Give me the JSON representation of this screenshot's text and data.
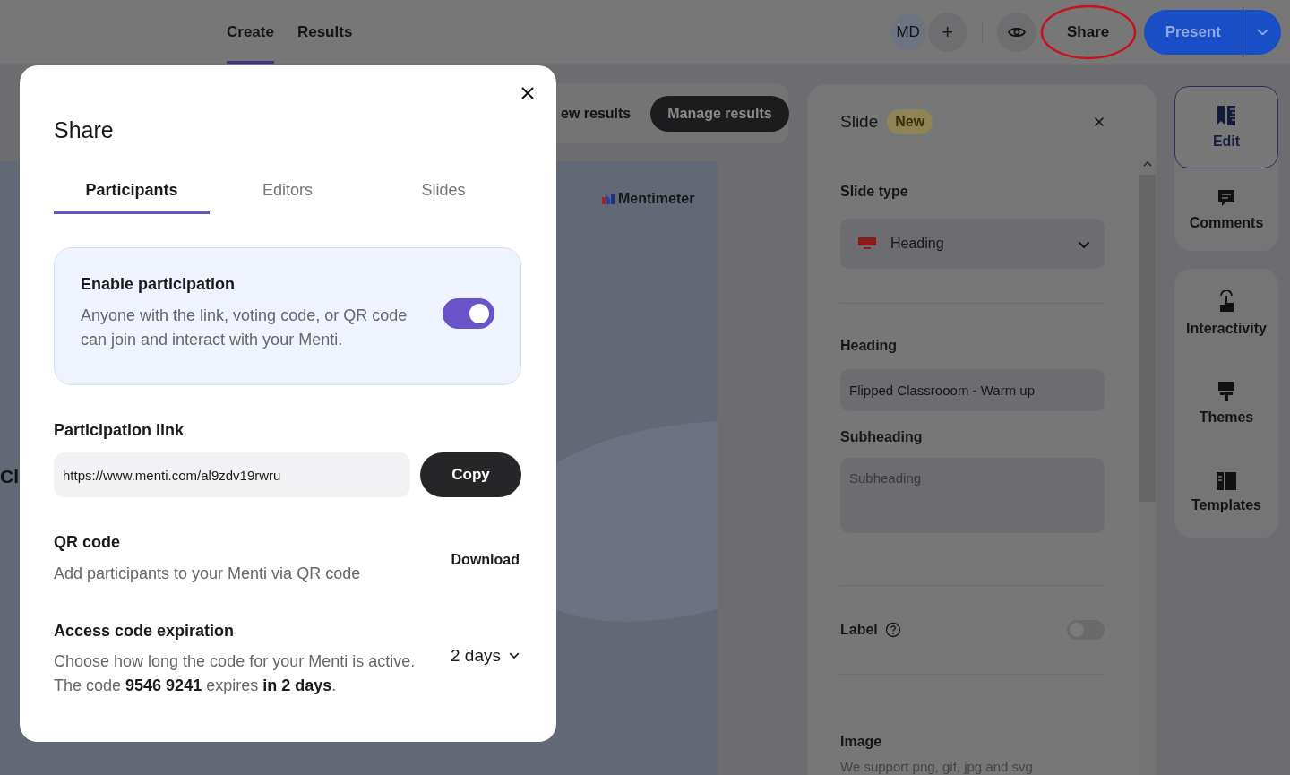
{
  "topbar": {
    "tabs": [
      {
        "label": "Create",
        "selected": true
      },
      {
        "label": "Results",
        "selected": false
      }
    ],
    "avatar": "MD",
    "add_button": "+",
    "share_button": "Share",
    "share_highlighted": true,
    "present_button": "Present"
  },
  "results_bar": {
    "view_results": "ew results",
    "manage_results": "Manage results"
  },
  "slide_preview": {
    "logo": "Mentimeter",
    "heading": "Cl"
  },
  "slide_panel": {
    "title": "Slide",
    "badge": "New",
    "slide_type_label": "Slide type",
    "slide_type": "Heading",
    "heading_label": "Heading",
    "heading_value": "Flipped Classrooom - Warm up",
    "subheading_label": "Subheading",
    "subheading_placeholder": "Subheading",
    "label_label": "Label",
    "label_on": false,
    "image_label": "Image",
    "image_hint": "We support png, gif, jpg and svg"
  },
  "side_rail": [
    {
      "kind": "edit",
      "label": "Edit",
      "selected": true
    },
    {
      "kind": "comments",
      "label": "Comments",
      "selected": false
    },
    {
      "kind": "interactivity",
      "label": "Interactivity",
      "selected": false
    },
    {
      "kind": "themes",
      "label": "Themes",
      "selected": false
    },
    {
      "kind": "templates",
      "label": "Templates",
      "selected": false
    }
  ],
  "share_dialog": {
    "title": "Share",
    "tabs": [
      {
        "label": "Participants",
        "selected": true
      },
      {
        "label": "Editors",
        "selected": false
      },
      {
        "label": "Slides",
        "selected": false
      }
    ],
    "participation": {
      "title": "Enable participation",
      "description": "Anyone with the link, voting code, or QR code can join and interact with your Menti.",
      "on": true
    },
    "link": {
      "label": "Participation link",
      "value": "https://www.menti.com/al9zdv19rwru",
      "copy_button": "Copy"
    },
    "qr": {
      "label": "QR code",
      "description": "Add participants to your Menti via QR code",
      "download": "Download"
    },
    "expiration": {
      "label": "Access code expiration",
      "description": "Choose how long the code for your Menti is active. The code **9546 9241** expires **in 2 days**.",
      "duration": "2 days"
    }
  }
}
